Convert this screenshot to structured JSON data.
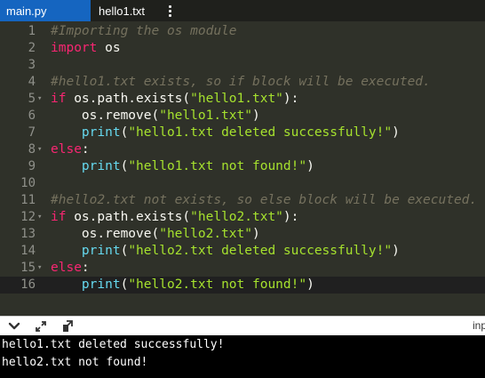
{
  "tabs": [
    {
      "label": "main.py",
      "active": true
    },
    {
      "label": "hello1.txt",
      "active": false
    }
  ],
  "editor": {
    "lines": [
      {
        "n": "1",
        "fold": false,
        "tokens": [
          {
            "t": "cm",
            "v": "#Importing the os module"
          }
        ]
      },
      {
        "n": "2",
        "fold": false,
        "tokens": [
          {
            "t": "kw",
            "v": "import"
          },
          {
            "t": "tx",
            "v": " os"
          }
        ]
      },
      {
        "n": "3",
        "fold": false,
        "tokens": []
      },
      {
        "n": "4",
        "fold": false,
        "tokens": [
          {
            "t": "cm",
            "v": "#hello1.txt exists, so if block will be executed."
          }
        ]
      },
      {
        "n": "5",
        "fold": true,
        "tokens": [
          {
            "t": "kw",
            "v": "if"
          },
          {
            "t": "tx",
            "v": " os.path.exists("
          },
          {
            "t": "str",
            "v": "\"hello1.txt\""
          },
          {
            "t": "tx",
            "v": "):"
          }
        ]
      },
      {
        "n": "6",
        "fold": false,
        "tokens": [
          {
            "t": "tx",
            "v": "    os.remove("
          },
          {
            "t": "str",
            "v": "\"hello1.txt\""
          },
          {
            "t": "tx",
            "v": ")"
          }
        ]
      },
      {
        "n": "7",
        "fold": false,
        "tokens": [
          {
            "t": "tx",
            "v": "    "
          },
          {
            "t": "fn",
            "v": "print"
          },
          {
            "t": "tx",
            "v": "("
          },
          {
            "t": "str",
            "v": "\"hello1.txt deleted successfully!\""
          },
          {
            "t": "tx",
            "v": ")"
          }
        ]
      },
      {
        "n": "8",
        "fold": true,
        "tokens": [
          {
            "t": "kw",
            "v": "else"
          },
          {
            "t": "tx",
            "v": ":"
          }
        ]
      },
      {
        "n": "9",
        "fold": false,
        "tokens": [
          {
            "t": "tx",
            "v": "    "
          },
          {
            "t": "fn",
            "v": "print"
          },
          {
            "t": "tx",
            "v": "("
          },
          {
            "t": "str",
            "v": "\"hello1.txt not found!\""
          },
          {
            "t": "tx",
            "v": ")"
          }
        ]
      },
      {
        "n": "10",
        "fold": false,
        "tokens": []
      },
      {
        "n": "11",
        "fold": false,
        "tokens": [
          {
            "t": "cm",
            "v": "#hello2.txt not exists, so else block will be executed."
          }
        ]
      },
      {
        "n": "12",
        "fold": true,
        "tokens": [
          {
            "t": "kw",
            "v": "if"
          },
          {
            "t": "tx",
            "v": " os.path.exists("
          },
          {
            "t": "str",
            "v": "\"hello2.txt\""
          },
          {
            "t": "tx",
            "v": "):"
          }
        ]
      },
      {
        "n": "13",
        "fold": false,
        "tokens": [
          {
            "t": "tx",
            "v": "    os.remove("
          },
          {
            "t": "str",
            "v": "\"hello2.txt\""
          },
          {
            "t": "tx",
            "v": ")"
          }
        ]
      },
      {
        "n": "14",
        "fold": false,
        "tokens": [
          {
            "t": "tx",
            "v": "    "
          },
          {
            "t": "fn",
            "v": "print"
          },
          {
            "t": "tx",
            "v": "("
          },
          {
            "t": "str",
            "v": "\"hello2.txt deleted successfully!\""
          },
          {
            "t": "tx",
            "v": ")"
          }
        ]
      },
      {
        "n": "15",
        "fold": true,
        "tokens": [
          {
            "t": "kw",
            "v": "else"
          },
          {
            "t": "tx",
            "v": ":"
          }
        ]
      },
      {
        "n": "16",
        "fold": false,
        "active": true,
        "tokens": [
          {
            "t": "tx",
            "v": "    "
          },
          {
            "t": "fn",
            "v": "print"
          },
          {
            "t": "tx",
            "v": "("
          },
          {
            "t": "str",
            "v": "\"hello2.txt not found!\""
          },
          {
            "t": "tx",
            "v": ")"
          }
        ]
      }
    ]
  },
  "toolbar": {
    "icons": [
      "chevron-down-icon",
      "expand-icon",
      "share-icon"
    ],
    "right_label": "input"
  },
  "console": {
    "output": [
      "hello1.txt deleted successfully!",
      "hello2.txt not found!"
    ]
  },
  "colors": {
    "tab_active": "#1565c0",
    "editor_bg": "#2f3129",
    "keyword": "#f92672",
    "string": "#a6e22e",
    "builtin": "#66d9ef",
    "comment": "#75715e"
  }
}
